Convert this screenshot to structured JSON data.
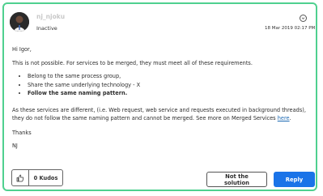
{
  "author": {
    "username": "nj_njoku",
    "status": "Inactive",
    "avatar_icon": "user-avatar"
  },
  "post": {
    "timestamp": "18 Mar 2019 02:17 PM",
    "greeting": "Hi Igor,",
    "intro": "This is not possible. For services to be merged, they must meet all of these requirements.",
    "requirements": [
      "Belong to the same process group,",
      "Share the same underlying technology - X",
      "Follow the same naming pattern."
    ],
    "explanation": "As these services are different, (i.e. Web request, web service and requests executed in background threads), they do not follow the same naming pattern and cannot be merged. See more on Merged Services",
    "link_text": "here",
    "explanation_end": ".",
    "thanks": "Thanks",
    "signature": "NJ"
  },
  "actions": {
    "kudos_label": "0 Kudos",
    "not_solution_label": "Not the solution",
    "reply_label": "Reply"
  },
  "colors": {
    "border_accent": "#4fd08f",
    "primary_button": "#1a73e8",
    "link": "#1e6ab4"
  }
}
